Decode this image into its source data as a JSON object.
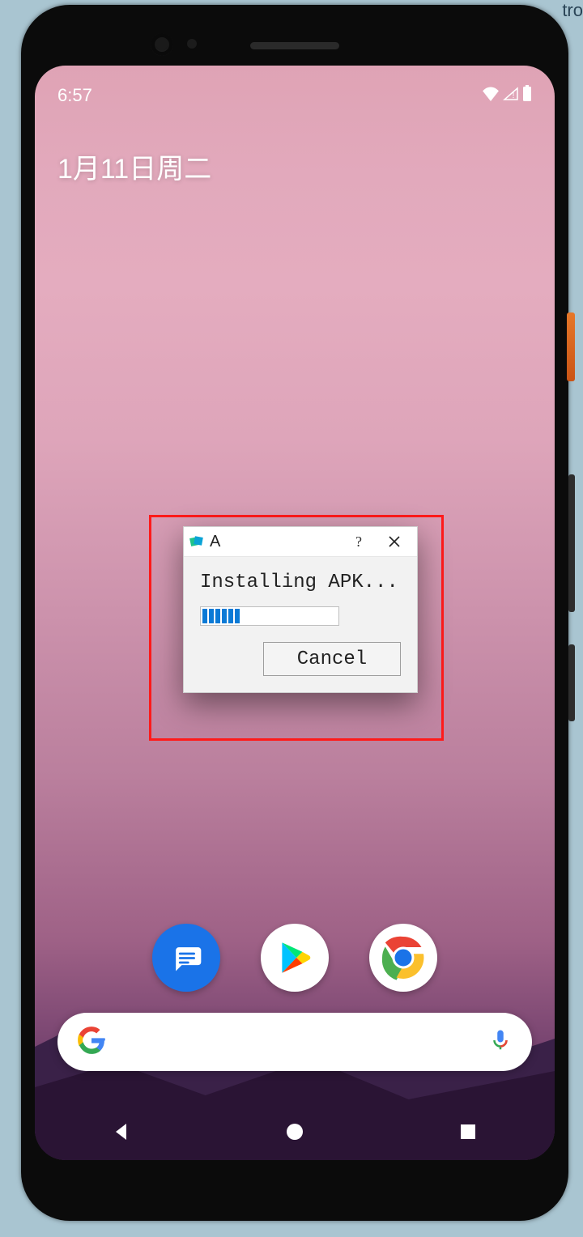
{
  "background_fragment": "tro",
  "status": {
    "time": "6:57"
  },
  "widgets": {
    "date": "1月11日周二"
  },
  "dock": {
    "items": [
      {
        "name": "messages"
      },
      {
        "name": "play-store"
      },
      {
        "name": "chrome"
      }
    ]
  },
  "dialog": {
    "title": "A",
    "help": "?",
    "message": "Installing APK...",
    "progress_segments": 6,
    "cancel_label": "Cancel"
  },
  "nav": {
    "back": "back",
    "home": "home",
    "recents": "recents"
  }
}
